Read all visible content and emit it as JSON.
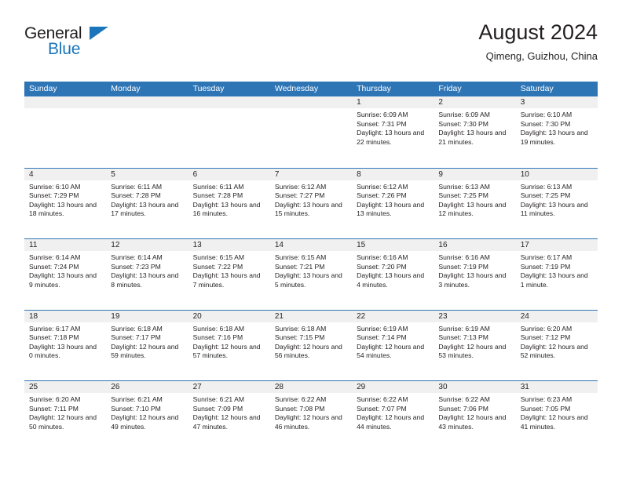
{
  "brand": {
    "line1": "General",
    "line2": "Blue",
    "triangle_color": "#1b75bb"
  },
  "header": {
    "title": "August 2024",
    "subtitle": "Qimeng, Guizhou, China"
  },
  "theme": {
    "header_blue": "#2e75b6",
    "day_band_gray": "#f0f0f0",
    "text": "#231f20"
  },
  "weekdays": [
    "Sunday",
    "Monday",
    "Tuesday",
    "Wednesday",
    "Thursday",
    "Friday",
    "Saturday"
  ],
  "labels": {
    "sunrise_prefix": "Sunrise:",
    "sunset_prefix": "Sunset:",
    "daylight_prefix": "Daylight:"
  },
  "weeks": [
    {
      "days": [
        {
          "number": "",
          "empty": true,
          "sunrise": "",
          "sunset": "",
          "daylight": ""
        },
        {
          "number": "",
          "empty": true,
          "sunrise": "",
          "sunset": "",
          "daylight": ""
        },
        {
          "number": "",
          "empty": true,
          "sunrise": "",
          "sunset": "",
          "daylight": ""
        },
        {
          "number": "",
          "empty": true,
          "sunrise": "",
          "sunset": "",
          "daylight": ""
        },
        {
          "number": "1",
          "empty": false,
          "sunrise": "Sunrise: 6:09 AM",
          "sunset": "Sunset: 7:31 PM",
          "daylight": "Daylight: 13 hours and 22 minutes."
        },
        {
          "number": "2",
          "empty": false,
          "sunrise": "Sunrise: 6:09 AM",
          "sunset": "Sunset: 7:30 PM",
          "daylight": "Daylight: 13 hours and 21 minutes."
        },
        {
          "number": "3",
          "empty": false,
          "sunrise": "Sunrise: 6:10 AM",
          "sunset": "Sunset: 7:30 PM",
          "daylight": "Daylight: 13 hours and 19 minutes."
        }
      ]
    },
    {
      "days": [
        {
          "number": "4",
          "empty": false,
          "sunrise": "Sunrise: 6:10 AM",
          "sunset": "Sunset: 7:29 PM",
          "daylight": "Daylight: 13 hours and 18 minutes."
        },
        {
          "number": "5",
          "empty": false,
          "sunrise": "Sunrise: 6:11 AM",
          "sunset": "Sunset: 7:28 PM",
          "daylight": "Daylight: 13 hours and 17 minutes."
        },
        {
          "number": "6",
          "empty": false,
          "sunrise": "Sunrise: 6:11 AM",
          "sunset": "Sunset: 7:28 PM",
          "daylight": "Daylight: 13 hours and 16 minutes."
        },
        {
          "number": "7",
          "empty": false,
          "sunrise": "Sunrise: 6:12 AM",
          "sunset": "Sunset: 7:27 PM",
          "daylight": "Daylight: 13 hours and 15 minutes."
        },
        {
          "number": "8",
          "empty": false,
          "sunrise": "Sunrise: 6:12 AM",
          "sunset": "Sunset: 7:26 PM",
          "daylight": "Daylight: 13 hours and 13 minutes."
        },
        {
          "number": "9",
          "empty": false,
          "sunrise": "Sunrise: 6:13 AM",
          "sunset": "Sunset: 7:25 PM",
          "daylight": "Daylight: 13 hours and 12 minutes."
        },
        {
          "number": "10",
          "empty": false,
          "sunrise": "Sunrise: 6:13 AM",
          "sunset": "Sunset: 7:25 PM",
          "daylight": "Daylight: 13 hours and 11 minutes."
        }
      ]
    },
    {
      "days": [
        {
          "number": "11",
          "empty": false,
          "sunrise": "Sunrise: 6:14 AM",
          "sunset": "Sunset: 7:24 PM",
          "daylight": "Daylight: 13 hours and 9 minutes."
        },
        {
          "number": "12",
          "empty": false,
          "sunrise": "Sunrise: 6:14 AM",
          "sunset": "Sunset: 7:23 PM",
          "daylight": "Daylight: 13 hours and 8 minutes."
        },
        {
          "number": "13",
          "empty": false,
          "sunrise": "Sunrise: 6:15 AM",
          "sunset": "Sunset: 7:22 PM",
          "daylight": "Daylight: 13 hours and 7 minutes."
        },
        {
          "number": "14",
          "empty": false,
          "sunrise": "Sunrise: 6:15 AM",
          "sunset": "Sunset: 7:21 PM",
          "daylight": "Daylight: 13 hours and 5 minutes."
        },
        {
          "number": "15",
          "empty": false,
          "sunrise": "Sunrise: 6:16 AM",
          "sunset": "Sunset: 7:20 PM",
          "daylight": "Daylight: 13 hours and 4 minutes."
        },
        {
          "number": "16",
          "empty": false,
          "sunrise": "Sunrise: 6:16 AM",
          "sunset": "Sunset: 7:19 PM",
          "daylight": "Daylight: 13 hours and 3 minutes."
        },
        {
          "number": "17",
          "empty": false,
          "sunrise": "Sunrise: 6:17 AM",
          "sunset": "Sunset: 7:19 PM",
          "daylight": "Daylight: 13 hours and 1 minute."
        }
      ]
    },
    {
      "days": [
        {
          "number": "18",
          "empty": false,
          "sunrise": "Sunrise: 6:17 AM",
          "sunset": "Sunset: 7:18 PM",
          "daylight": "Daylight: 13 hours and 0 minutes."
        },
        {
          "number": "19",
          "empty": false,
          "sunrise": "Sunrise: 6:18 AM",
          "sunset": "Sunset: 7:17 PM",
          "daylight": "Daylight: 12 hours and 59 minutes."
        },
        {
          "number": "20",
          "empty": false,
          "sunrise": "Sunrise: 6:18 AM",
          "sunset": "Sunset: 7:16 PM",
          "daylight": "Daylight: 12 hours and 57 minutes."
        },
        {
          "number": "21",
          "empty": false,
          "sunrise": "Sunrise: 6:18 AM",
          "sunset": "Sunset: 7:15 PM",
          "daylight": "Daylight: 12 hours and 56 minutes."
        },
        {
          "number": "22",
          "empty": false,
          "sunrise": "Sunrise: 6:19 AM",
          "sunset": "Sunset: 7:14 PM",
          "daylight": "Daylight: 12 hours and 54 minutes."
        },
        {
          "number": "23",
          "empty": false,
          "sunrise": "Sunrise: 6:19 AM",
          "sunset": "Sunset: 7:13 PM",
          "daylight": "Daylight: 12 hours and 53 minutes."
        },
        {
          "number": "24",
          "empty": false,
          "sunrise": "Sunrise: 6:20 AM",
          "sunset": "Sunset: 7:12 PM",
          "daylight": "Daylight: 12 hours and 52 minutes."
        }
      ]
    },
    {
      "days": [
        {
          "number": "25",
          "empty": false,
          "sunrise": "Sunrise: 6:20 AM",
          "sunset": "Sunset: 7:11 PM",
          "daylight": "Daylight: 12 hours and 50 minutes."
        },
        {
          "number": "26",
          "empty": false,
          "sunrise": "Sunrise: 6:21 AM",
          "sunset": "Sunset: 7:10 PM",
          "daylight": "Daylight: 12 hours and 49 minutes."
        },
        {
          "number": "27",
          "empty": false,
          "sunrise": "Sunrise: 6:21 AM",
          "sunset": "Sunset: 7:09 PM",
          "daylight": "Daylight: 12 hours and 47 minutes."
        },
        {
          "number": "28",
          "empty": false,
          "sunrise": "Sunrise: 6:22 AM",
          "sunset": "Sunset: 7:08 PM",
          "daylight": "Daylight: 12 hours and 46 minutes."
        },
        {
          "number": "29",
          "empty": false,
          "sunrise": "Sunrise: 6:22 AM",
          "sunset": "Sunset: 7:07 PM",
          "daylight": "Daylight: 12 hours and 44 minutes."
        },
        {
          "number": "30",
          "empty": false,
          "sunrise": "Sunrise: 6:22 AM",
          "sunset": "Sunset: 7:06 PM",
          "daylight": "Daylight: 12 hours and 43 minutes."
        },
        {
          "number": "31",
          "empty": false,
          "sunrise": "Sunrise: 6:23 AM",
          "sunset": "Sunset: 7:05 PM",
          "daylight": "Daylight: 12 hours and 41 minutes."
        }
      ]
    }
  ]
}
